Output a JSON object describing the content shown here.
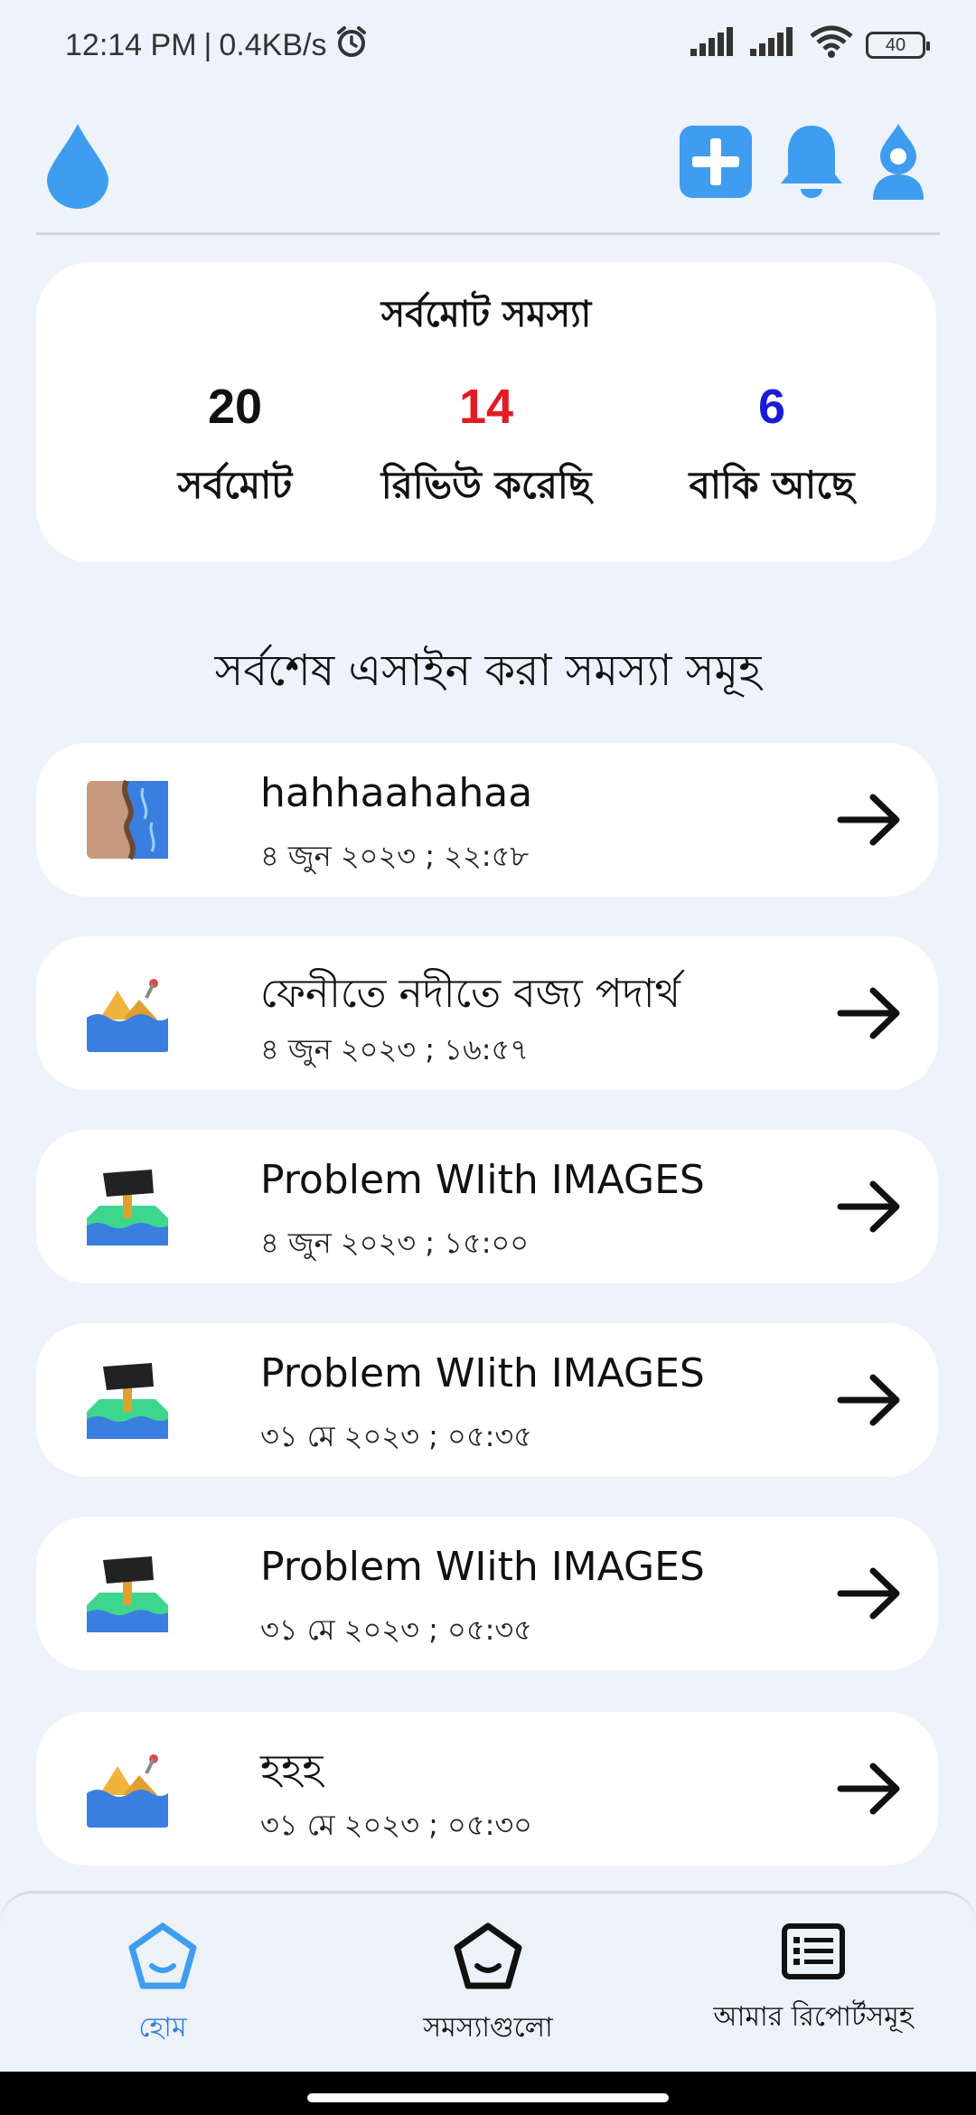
{
  "status_bar": {
    "time": "12:14 PM",
    "separator": "|",
    "speed": "0.4KB/s",
    "battery": "40",
    "icons": [
      "alarm-icon",
      "signal-icon",
      "signal-icon",
      "wifi-icon",
      "battery-icon"
    ]
  },
  "app_bar": {
    "logo_icon": "water-drop-icon",
    "actions": [
      "add-icon",
      "bell-icon",
      "profile-icon"
    ],
    "accent": "#3f9df0"
  },
  "summary": {
    "title": "সর্বমোট সমস্যা",
    "stats": [
      {
        "value": "20",
        "label": "সর্বমোট",
        "color": "#111111"
      },
      {
        "value": "14",
        "label": "রিভিউ করেছি",
        "color": "#e31b23"
      },
      {
        "value": "6",
        "label": "বাকি আছে",
        "color": "#1a1ad6"
      }
    ]
  },
  "section_title": "সর্বশেষ এসাইন করা সমস্যা সমূহ",
  "problems": [
    {
      "title": "hahhaahahaa",
      "date": "৪ জুন ২০২৩ ; ২২:৫৮",
      "icon": "river-bank-icon"
    },
    {
      "title": "ফেনীতে নদীতে বজ্য পদার্থ",
      "date": "৪ জুন ২০২৩ ; ১৬:৫৭",
      "icon": "waste-in-water-icon"
    },
    {
      "title": "Problem WIith IMAGES",
      "date": "৪ জুন ২০২৩ ; ১৫:০০",
      "icon": "sign-board-icon"
    },
    {
      "title": "Problem WIith IMAGES",
      "date": "৩১ মে ২০২৩ ; ০৫:৩৫",
      "icon": "sign-board-icon"
    },
    {
      "title": "Problem WIith IMAGES",
      "date": "৩১ মে ২০২৩ ; ০৫:৩৫",
      "icon": "sign-board-icon"
    },
    {
      "title": "হহহ",
      "date": "৩১ মে ২০২৩ ; ০৫:৩০",
      "icon": "waste-in-water-icon"
    }
  ],
  "bottom_nav": [
    {
      "label": "হোম",
      "icon": "home-face-icon",
      "active": true
    },
    {
      "label": "সমস্যাগুলো",
      "icon": "problems-face-icon",
      "active": false
    },
    {
      "label": "আমার রিপোর্টসমূহ",
      "icon": "report-list-icon",
      "active": false
    }
  ]
}
